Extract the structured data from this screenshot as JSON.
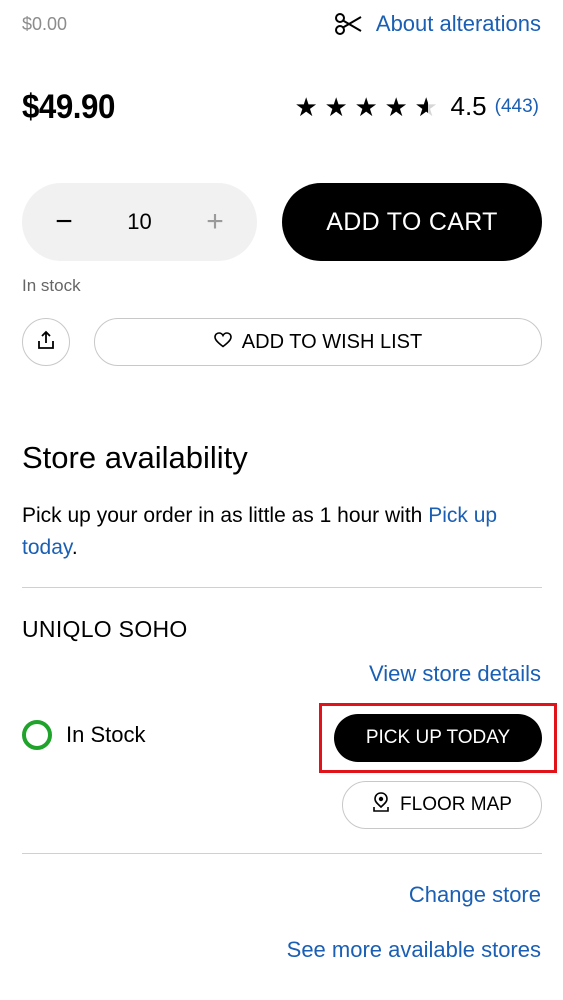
{
  "header": {
    "alteration_price": "$0.00",
    "alterations_link": "About alterations",
    "alterations_icon": "scissors-icon"
  },
  "product": {
    "price": "$49.90",
    "rating": {
      "stars_value": 4.5,
      "value_text": "4.5",
      "count": "(443)"
    },
    "quantity": {
      "value": "10",
      "minus_label": "−",
      "plus_label": "+"
    },
    "add_to_cart_label": "ADD TO CART",
    "stock_text": "In stock",
    "share_icon": "share-icon",
    "wish_list_label": "ADD TO WISH LIST",
    "wish_icon": "heart-outline-icon"
  },
  "store_availability": {
    "heading": "Store availability",
    "desc_prefix": "Pick up your order in as little as 1 hour with ",
    "desc_link": "Pick up today",
    "desc_suffix": ".",
    "store_name": "UNIQLO SOHO",
    "view_details_link": "View store details",
    "stock_status": "In Stock",
    "stock_color": "#1fa32b",
    "pickup_button": "PICK UP TODAY",
    "floor_map_button": "FLOOR MAP",
    "floor_map_icon": "map-pin-icon",
    "change_store_link": "Change store",
    "more_stores_link": "See more available stores"
  },
  "colors": {
    "link": "#1a5fb4",
    "highlight": "#e0131b",
    "primary_button": "#000000"
  }
}
